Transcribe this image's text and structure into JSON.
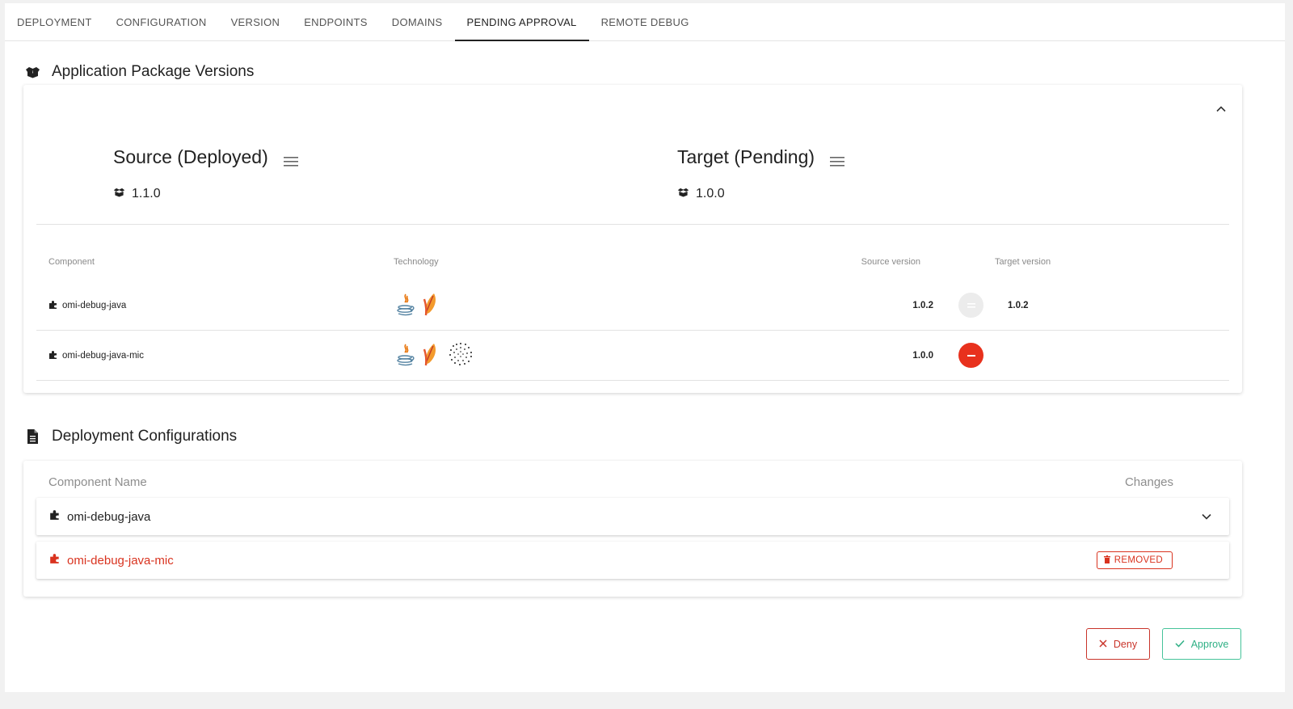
{
  "tabs": [
    {
      "label": "DEPLOYMENT"
    },
    {
      "label": "CONFIGURATION"
    },
    {
      "label": "VERSION"
    },
    {
      "label": "ENDPOINTS"
    },
    {
      "label": "DOMAINS"
    },
    {
      "label": "PENDING APPROVAL",
      "active": true
    },
    {
      "label": "REMOTE DEBUG"
    }
  ],
  "package_versions": {
    "title": "Application Package Versions",
    "source": {
      "title": "Source (Deployed)",
      "version": "1.1.0"
    },
    "target": {
      "title": "Target (Pending)",
      "version": "1.0.0"
    },
    "columns": {
      "component": "Component",
      "technology": "Technology",
      "source_version": "Source version",
      "target_version": "Target version"
    },
    "rows": [
      {
        "component": "omi-debug-java",
        "technologies": [
          "java-icon",
          "apache-feather-icon"
        ],
        "source_version": "1.0.2",
        "status": "equal",
        "target_version": "1.0.2"
      },
      {
        "component": "omi-debug-java-mic",
        "technologies": [
          "java-icon",
          "apache-feather-icon",
          "dotted-sphere-icon"
        ],
        "source_version": "1.0.0",
        "status": "removed",
        "target_version": ""
      }
    ]
  },
  "deployment_configurations": {
    "title": "Deployment Configurations",
    "columns": {
      "component_name": "Component Name",
      "changes": "Changes"
    },
    "rows": [
      {
        "name": "omi-debug-java",
        "state": "expandable"
      },
      {
        "name": "omi-debug-java-mic",
        "state": "removed",
        "tag": "REMOVED"
      }
    ]
  },
  "actions": {
    "deny": "Deny",
    "approve": "Approve"
  },
  "colors": {
    "removed": "#d9331f",
    "approve": "#2fb085",
    "deny": "#c9342a",
    "equal_badge": "#ececec"
  }
}
